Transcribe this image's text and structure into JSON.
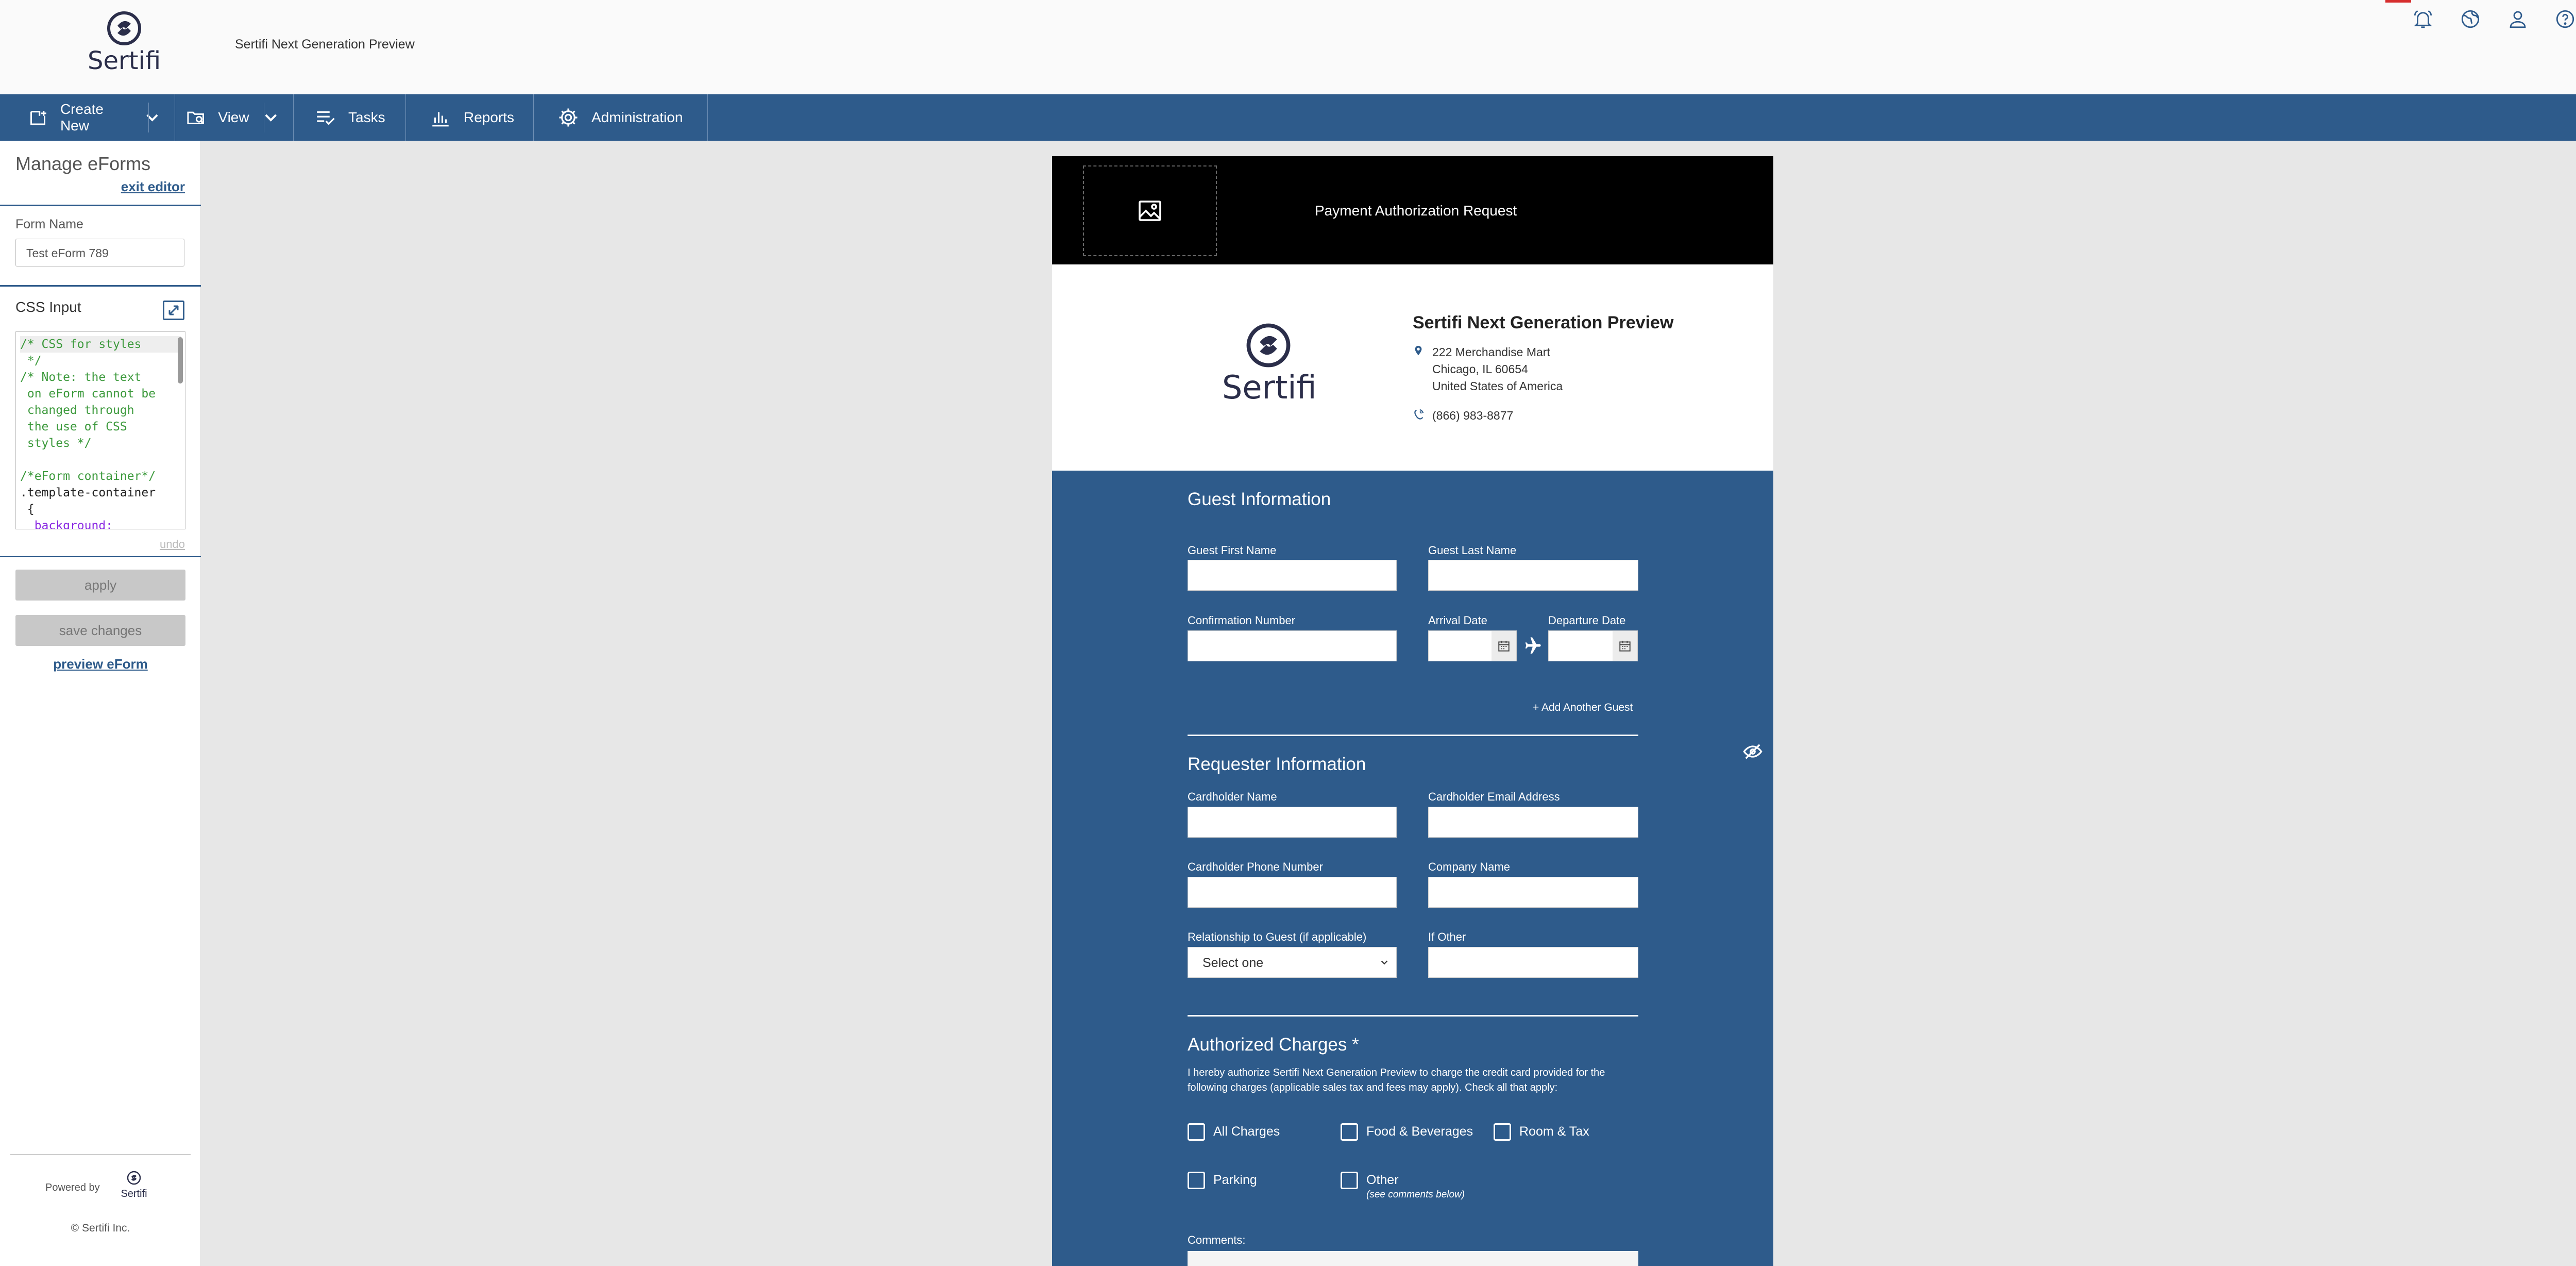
{
  "app": {
    "logo_text": "Sertifi",
    "title": "Sertifi Next Generation Preview"
  },
  "header_icons": [
    "bell-icon",
    "globe-icon",
    "user-icon",
    "help-icon"
  ],
  "nav": {
    "create_new": "Create New",
    "view": "View",
    "tasks": "Tasks",
    "reports": "Reports",
    "administration": "Administration"
  },
  "editor": {
    "title": "Manage eForms",
    "exit_label": "exit editor",
    "form_name_label": "Form Name",
    "form_name_value": "Test eForm 789",
    "css_input_label": "CSS Input",
    "css_lines": [
      {
        "text": "/* CSS for styles",
        "kind": "comment"
      },
      {
        "text": " */",
        "kind": "comment"
      },
      {
        "text": "/* Note: the text",
        "kind": "comment"
      },
      {
        "text": " on eForm cannot be",
        "kind": "comment"
      },
      {
        "text": " changed through",
        "kind": "comment"
      },
      {
        "text": " the use of CSS",
        "kind": "comment"
      },
      {
        "text": " styles */",
        "kind": "comment"
      },
      {
        "text": "",
        "kind": "comment"
      },
      {
        "text": "/*eForm container*/",
        "kind": "comment"
      },
      {
        "text": ".template-container",
        "kind": "sel"
      },
      {
        "text": " {",
        "kind": "sel"
      },
      {
        "text": "  background:",
        "kind": "prop"
      }
    ],
    "undo_label": "undo",
    "apply_label": "apply",
    "save_label": "save changes",
    "preview_label": "preview eForm",
    "powered_by": "Powered by",
    "powered_logo": "Sertifi",
    "copyright": "© Sertifi Inc."
  },
  "form": {
    "header_title": "Payment Authorization Request",
    "company": {
      "name": "Sertifi Next Generation Preview",
      "address1": "222 Merchandise Mart",
      "address2": "Chicago, IL 60654",
      "address3": "United States of America",
      "phone": "(866) 983-8877",
      "logo_text": "Sertifi"
    },
    "guest": {
      "title": "Guest Information",
      "first_name": "Guest First Name",
      "last_name": "Guest Last Name",
      "confirmation": "Confirmation Number",
      "arrival": "Arrival Date",
      "departure": "Departure Date",
      "add_guest": "+ Add Another Guest"
    },
    "requester": {
      "title": "Requester Information",
      "cardholder_name": "Cardholder Name",
      "cardholder_email": "Cardholder Email Address",
      "cardholder_phone": "Cardholder Phone Number",
      "company_name": "Company Name",
      "relationship": "Relationship to Guest (if applicable)",
      "relationship_value": "Select one",
      "if_other": "If Other"
    },
    "charges": {
      "title": "Authorized Charges *",
      "text": "I hereby authorize Sertifi Next Generation Preview to charge the credit card provided for the following charges (applicable sales tax and fees may apply). Check all that apply:",
      "all": "All Charges",
      "food": "Food & Beverages",
      "room": "Room & Tax",
      "parking": "Parking",
      "other": "Other",
      "other_note": "(see comments below)",
      "comments": "Comments:"
    }
  }
}
